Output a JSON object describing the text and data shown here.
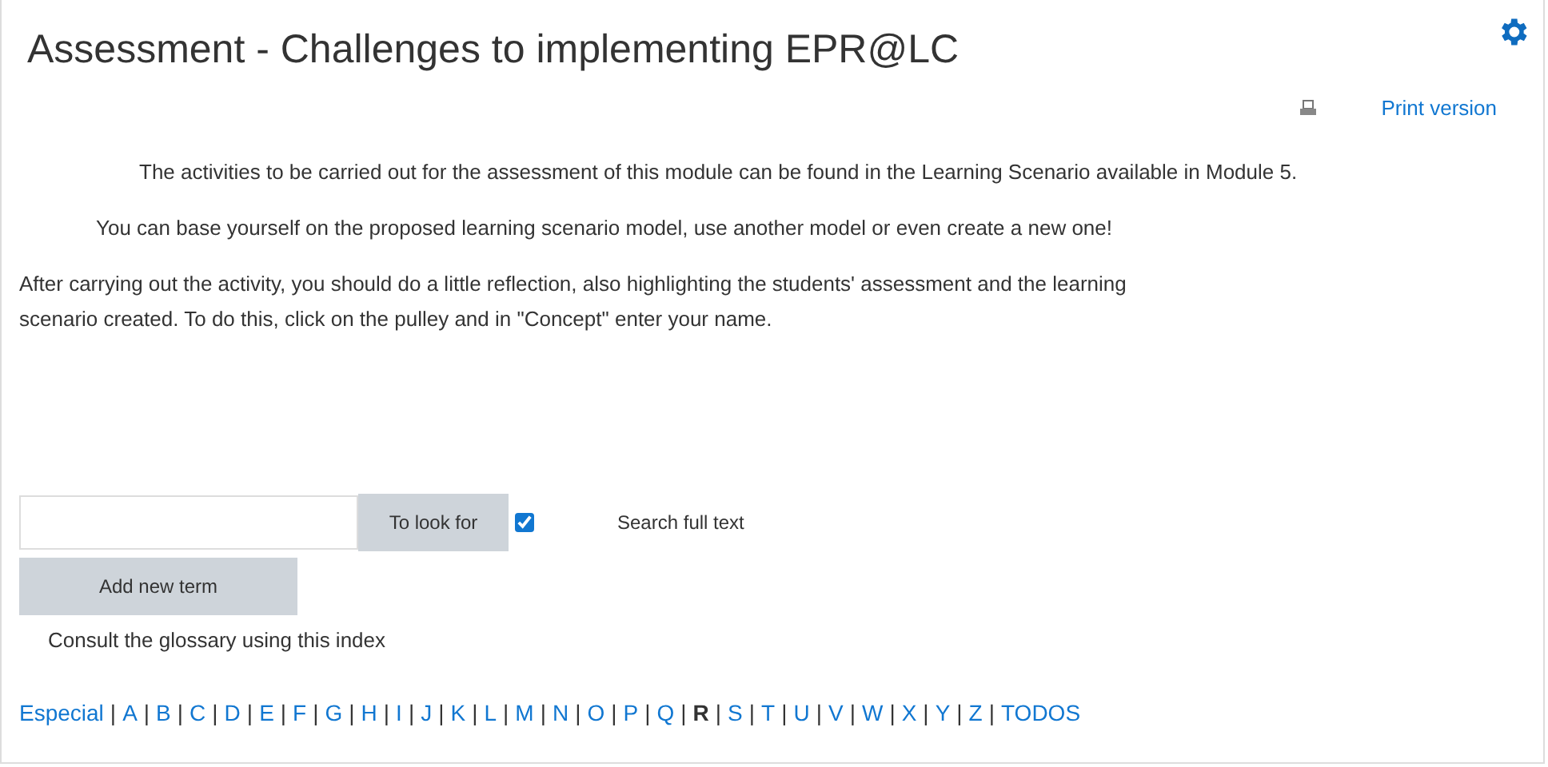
{
  "title": "Assessment - Challenges to implementing EPR@LC",
  "print_link": "Print version",
  "paragraphs": [
    "The activities to be carried out for the assessment of this module can be found in the Learning Scenario available in Module 5.",
    "You can base yourself on the proposed learning scenario model, use another model or even create a new one!",
    "After carrying out the activity, you should do a little reflection, also highlighting the students' assessment and the learning scenario created. To do this, click on the pulley and in \"Concept\" enter your name."
  ],
  "search": {
    "button": "To look for",
    "full_text": {
      "label": "Search full text",
      "checked": true
    }
  },
  "add_button": "Add new term",
  "index_hint": "Consult the glossary using this index",
  "index": [
    {
      "label": "Especial",
      "selected": false
    },
    {
      "label": "A",
      "selected": false
    },
    {
      "label": "B",
      "selected": false
    },
    {
      "label": "C",
      "selected": false
    },
    {
      "label": "D",
      "selected": false
    },
    {
      "label": "E",
      "selected": false
    },
    {
      "label": "F",
      "selected": false
    },
    {
      "label": "G",
      "selected": false
    },
    {
      "label": "H",
      "selected": false
    },
    {
      "label": "I",
      "selected": false
    },
    {
      "label": "J",
      "selected": false
    },
    {
      "label": "K",
      "selected": false
    },
    {
      "label": "L",
      "selected": false
    },
    {
      "label": "M",
      "selected": false
    },
    {
      "label": "N",
      "selected": false
    },
    {
      "label": "O",
      "selected": false
    },
    {
      "label": "P",
      "selected": false
    },
    {
      "label": "Q",
      "selected": false
    },
    {
      "label": "R",
      "selected": true
    },
    {
      "label": "S",
      "selected": false
    },
    {
      "label": "T",
      "selected": false
    },
    {
      "label": "U",
      "selected": false
    },
    {
      "label": "V",
      "selected": false
    },
    {
      "label": "W",
      "selected": false
    },
    {
      "label": "X",
      "selected": false
    },
    {
      "label": "Y",
      "selected": false
    },
    {
      "label": "Z",
      "selected": false
    },
    {
      "label": "TODOS",
      "selected": false
    }
  ],
  "index_separator": "|"
}
